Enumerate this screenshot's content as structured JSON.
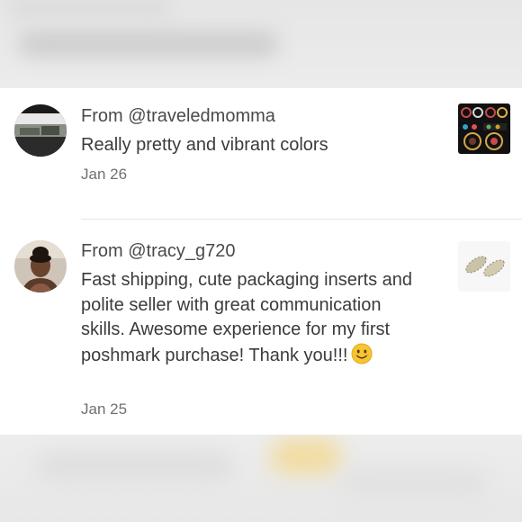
{
  "reviews": [
    {
      "from": "From @traveledmomma",
      "comment": "Really pretty and vibrant colors",
      "date": "Jan 26",
      "thumbnail_icon": "earrings-photo-thumbnail",
      "avatar_icon": "user-avatar-landscape"
    },
    {
      "from": "From @tracy_g720",
      "comment": "Fast shipping, cute packaging inserts and polite seller with great communication skills. Awesome experience for my first poshmark purchase! Thank you!!!",
      "emoji": "smiling-face-emoji",
      "date": "Jan 25",
      "thumbnail_icon": "sage-bundles-photo-thumbnail",
      "avatar_icon": "user-avatar-portrait"
    }
  ],
  "colors": {
    "card_background": "#ffffff",
    "backdrop": "#f3f3f3",
    "divider": "#e6e6e6",
    "text_primary": "#3d3d3d",
    "text_secondary": "#707070"
  }
}
